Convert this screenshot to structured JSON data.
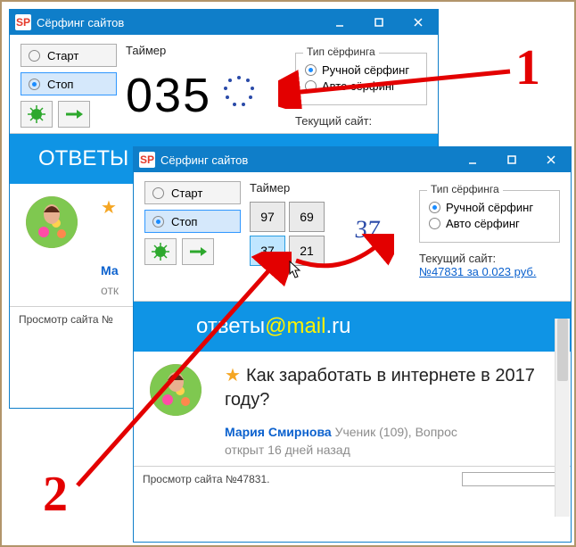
{
  "window_title": "Сёрфинг сайтов",
  "buttons": {
    "start": "Старт",
    "stop": "Стоп"
  },
  "timer_label": "Таймер",
  "surf_type": {
    "legend": "Тип сёрфинга",
    "manual": "Ручной сёрфинг",
    "auto": "Авто сёрфинг"
  },
  "current_site_label": "Текущий сайт:",
  "w1": {
    "timer": "035"
  },
  "w1_status": "Просмотр сайта №",
  "w2": {
    "numbers": [
      "97",
      "69",
      "37",
      "21"
    ],
    "selected": "37",
    "captcha": "37",
    "current_link": "№47831 за 0.023 руб. ",
    "status": "Просмотр сайта №47831."
  },
  "site": {
    "brand_prefix": "ответы",
    "brand_mail": "@mail",
    "brand_suffix": ".ru",
    "brand_cut": "ОТВЕТЫ",
    "question": "Как заработать в интернете в 2017 году?",
    "user": "Мария Смирнова",
    "rank": "Ученик (109), Вопрос",
    "age": "открыт 16 дней назад",
    "user_cut": "Ма",
    "age_cut": "отк"
  },
  "markers": {
    "one": "1",
    "two": "2"
  }
}
